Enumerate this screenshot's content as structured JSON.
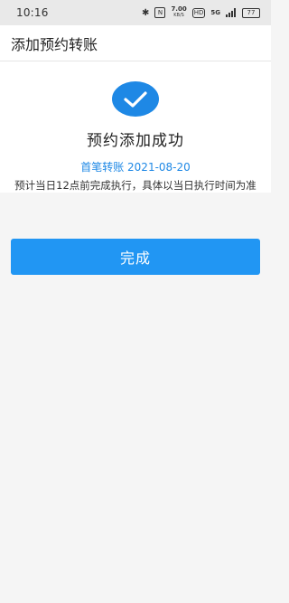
{
  "status_bar": {
    "time": "10:16",
    "speed_value": "7.00",
    "speed_unit": "KB/S",
    "hd_label": "HD",
    "network_label": "5G",
    "battery_level": "77",
    "icons": [
      "bluetooth-icon",
      "nfc-icon",
      "hd-icon",
      "network-5g-icon",
      "wifi-icon",
      "battery-icon"
    ]
  },
  "header": {
    "title": "添加预约转账"
  },
  "result": {
    "icon": "check-icon",
    "title": "预约添加成功",
    "first_transfer": "首笔转账 2021-08-20",
    "note": "预计当日12点前完成执行，具体以当日执行时间为准"
  },
  "actions": {
    "done_label": "完成"
  },
  "colors": {
    "accent": "#1e88e5",
    "button": "#2196f3",
    "page_bg": "#f5f5f5"
  }
}
